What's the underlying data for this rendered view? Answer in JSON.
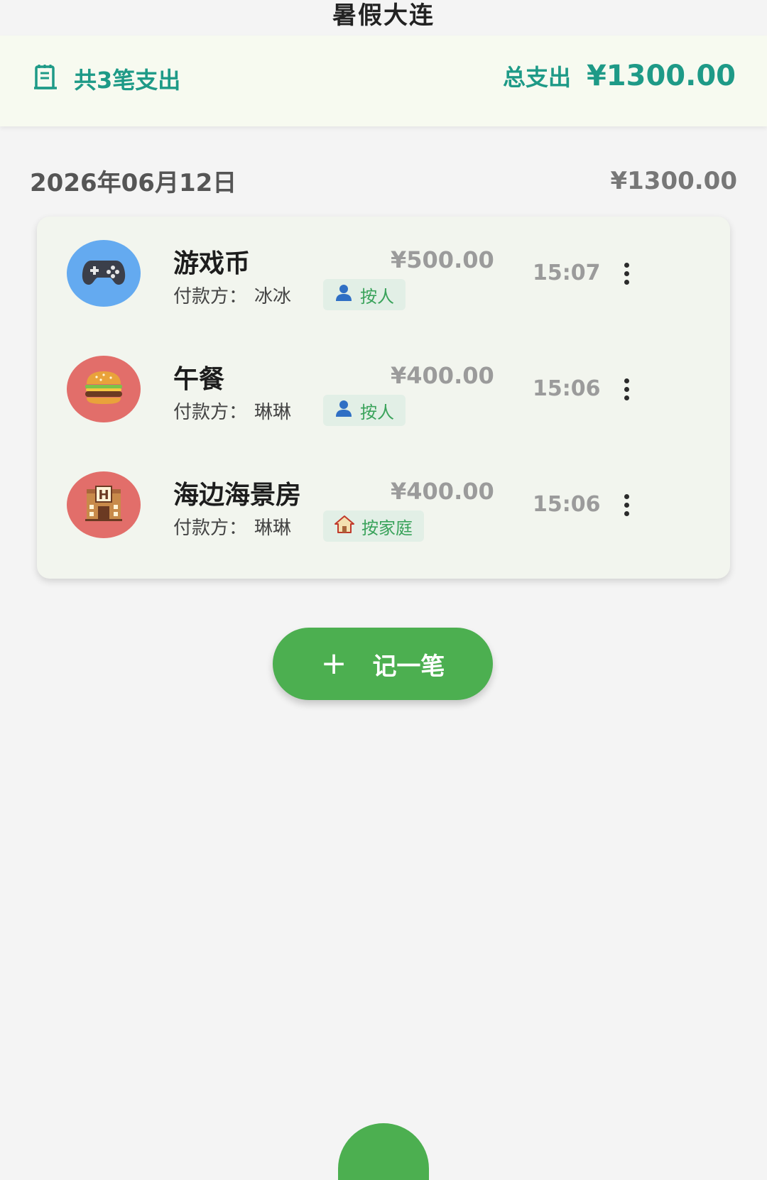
{
  "header": {
    "title": "暑假大连"
  },
  "summary": {
    "count_label": "共3笔支出",
    "total_label": "总支出",
    "total_value": "¥1300.00",
    "icon": "receipt-icon"
  },
  "day_group": {
    "date": "2026年06月12日",
    "total": "¥1300.00"
  },
  "expenses": [
    {
      "name": "游戏币",
      "payer_label": "付款方：",
      "payer": "冰冰",
      "split_tag": "按人",
      "split_icon": "person-icon",
      "amount": "¥500.00",
      "time": "15:07",
      "category_icon": "gamepad-icon",
      "avatar_color": "#64aaf0"
    },
    {
      "name": "午餐",
      "payer_label": "付款方：",
      "payer": "琳琳",
      "split_tag": "按人",
      "split_icon": "person-icon",
      "amount": "¥400.00",
      "time": "15:06",
      "category_icon": "burger-icon",
      "avatar_color": "#e26e6a"
    },
    {
      "name": "海边海景房",
      "payer_label": "付款方：",
      "payer": "琳琳",
      "split_tag": "按家庭",
      "split_icon": "house-icon",
      "amount": "¥400.00",
      "time": "15:06",
      "category_icon": "hotel-icon",
      "avatar_color": "#e26e6a"
    }
  ],
  "add_button": {
    "label": "记一笔",
    "icon": "plus-icon"
  },
  "colors": {
    "accent": "#1e9a87",
    "button": "#4caf50",
    "tag_text": "#3aa35b"
  }
}
